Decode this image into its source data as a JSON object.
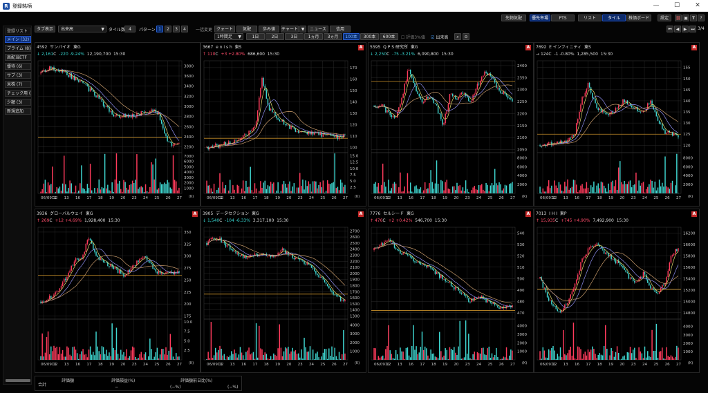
{
  "window": {
    "title": "登録銘柄",
    "icon_label": "R"
  },
  "toolbar_top_right": [
    "先物気配",
    "優先市場",
    "PTS",
    "リスト",
    "タイル",
    "株価ボード",
    "設定"
  ],
  "page_indicator": "3/4",
  "toolbar": {
    "tab_display": "タブ表示",
    "market_select": "出来高",
    "tile_count_label": "タイル数",
    "tile_count": "4",
    "pattern_label": "パターン",
    "patterns": [
      "1",
      "2",
      "3",
      "4"
    ],
    "bulk_change": "一括変更",
    "views": [
      "クォート",
      "気配",
      "歩み値",
      "チャート",
      "ニュース",
      "信用"
    ],
    "interval": "1時間足",
    "ranges": [
      "1日",
      "2日",
      "3日",
      "1ヵ月",
      "3ヵ月",
      "100本",
      "300本",
      "600本"
    ],
    "range_active": "100本",
    "check_eval": "評価3%値",
    "check_volume": "出来高"
  },
  "sidebar": {
    "header": "登録リスト",
    "items": [
      {
        "label": "メイン (32)",
        "active": true
      },
      {
        "label": "プライム (8)",
        "active": false
      },
      {
        "label": "高配当ETF",
        "active": false
      },
      {
        "label": "優待 (6)",
        "active": false
      },
      {
        "label": "サブ (3)",
        "active": false
      },
      {
        "label": "米株 (7)",
        "active": false
      },
      {
        "label": "チェック用 (",
        "active": false
      },
      {
        "label": "少額 (3)",
        "active": false
      },
      {
        "label": "新規追加",
        "active": false
      }
    ]
  },
  "x_axis_labels": [
    "06/0911",
    "12",
    "13",
    "16",
    "17",
    "18",
    "19",
    "20",
    "23",
    "24",
    "25",
    "26",
    "27"
  ],
  "volume_unit": "(K)",
  "colors": {
    "up": "#ff3b5c",
    "down": "#3fd6d0",
    "ma1": "#e6dd6e",
    "ma2": "#8f8ff0",
    "ma3": "#c79a6a",
    "hline": "#c8902a"
  },
  "panels": [
    {
      "code": "4592",
      "name": "サンバイオ",
      "market": "東G",
      "price": "2,161",
      "flag": "C",
      "change": "-220",
      "pct": "-9.24%",
      "volume": "12,190,700",
      "time": "15:30",
      "dir": "down",
      "arrow": "↓",
      "alert": false,
      "price_ticks": [
        "3800",
        "3600",
        "3400",
        "3200",
        "3000",
        "2800",
        "2600",
        "2400",
        "2200"
      ],
      "price_min": 2100,
      "price_max": 3900,
      "vol_ticks": [
        "7000",
        "6000",
        "5000",
        "4000",
        "3000",
        "2000",
        "1000"
      ],
      "vol_max": 7500,
      "hline": 2380,
      "path": [
        3650,
        3760,
        3720,
        3690,
        3620,
        3550,
        3480,
        3330,
        3220,
        3060,
        2900,
        2800,
        2840,
        2800,
        2850,
        2880,
        2930,
        2870,
        2400,
        2200,
        2230
      ]
    },
    {
      "code": "3667",
      "name": "e n i s h",
      "market": "東S",
      "price": "110",
      "flag": "C",
      "change": "+3",
      "pct": "+2.80%",
      "volume": "686,600",
      "time": "15:30",
      "dir": "up",
      "arrow": "↑",
      "alert": true,
      "price_ticks": [
        "170",
        "160",
        "150",
        "140",
        "130",
        "120",
        "110",
        "100"
      ],
      "price_min": 96,
      "price_max": 176,
      "vol_ticks": [
        "15.0",
        "12.5",
        "10.0",
        "7.5",
        "5.0",
        "2.5"
      ],
      "vol_max": 16,
      "hline": 108,
      "path": [
        100,
        101,
        102,
        104,
        105,
        108,
        112,
        118,
        160,
        135,
        128,
        122,
        118,
        115,
        114,
        113,
        112,
        111,
        110,
        109,
        110
      ]
    },
    {
      "code": "5595",
      "name": "Q P S 研究所",
      "market": "東G",
      "price": "2,250",
      "flag": "C",
      "change": "-75",
      "pct": "-3.21%",
      "volume": "6,090,800",
      "time": "15:30",
      "dir": "down",
      "arrow": "↓",
      "alert": true,
      "price_ticks": [
        "2400",
        "2350",
        "2300",
        "2250",
        "2200",
        "2150",
        "2100",
        "2050"
      ],
      "price_min": 2040,
      "price_max": 2420,
      "vol_ticks": [
        "8000",
        "6000",
        "4000",
        "2000"
      ],
      "vol_max": 9000,
      "hline": 2335,
      "path": [
        2230,
        2240,
        2200,
        2180,
        2260,
        2390,
        2300,
        2250,
        2270,
        2230,
        2150,
        2280,
        2260,
        2290,
        2250,
        2320,
        2380,
        2350,
        2300,
        2280,
        2250
      ]
    },
    {
      "code": "7692",
      "name": "E インフィニティ",
      "market": "東S",
      "price": "124",
      "flag": "C",
      "change": "-1",
      "pct": "-0.80%",
      "volume": "1,285,500",
      "time": "15:30",
      "dir": "neutral",
      "arrow": "→",
      "alert": true,
      "price_ticks": [
        "155",
        "150",
        "145",
        "140",
        "135",
        "130",
        "125",
        "120"
      ],
      "price_min": 117,
      "price_max": 158,
      "vol_ticks": [
        "8000",
        "6000",
        "4000",
        "2000"
      ],
      "vol_max": 9000,
      "hline": 125,
      "path": [
        120,
        120,
        121,
        121,
        122,
        125,
        140,
        148,
        138,
        135,
        134,
        136,
        140,
        138,
        136,
        135,
        140,
        132,
        126,
        125,
        124
      ]
    },
    {
      "code": "3936",
      "name": "グローバルウェイ",
      "market": "東G",
      "price": "269",
      "flag": "C",
      "change": "+12",
      "pct": "+4.69%",
      "volume": "1,928,400",
      "time": "15:30",
      "dir": "up",
      "arrow": "↑",
      "alert": true,
      "price_ticks": [
        "350",
        "325",
        "300",
        "275",
        "250",
        "225",
        "200",
        "175"
      ],
      "price_min": 170,
      "price_max": 360,
      "vol_ticks": [
        "10.0",
        "7.5",
        "5.0",
        "2.5"
      ],
      "vol_max": 10.5,
      "hline": 260,
      "path": [
        205,
        210,
        220,
        240,
        265,
        290,
        300,
        340,
        300,
        285,
        280,
        270,
        260,
        275,
        290,
        300,
        280,
        265,
        262,
        266,
        269
      ]
    },
    {
      "code": "3905",
      "name": "データセクション",
      "market": "東G",
      "price": "1,540",
      "flag": "C",
      "change": "-104",
      "pct": "-6.33%",
      "volume": "3,317,100",
      "time": "15:30",
      "dir": "down",
      "arrow": "↓",
      "alert": true,
      "price_ticks": [
        "2700",
        "2600",
        "2500",
        "2400",
        "2300",
        "2200",
        "2100",
        "2000",
        "1900",
        "1800",
        "1700",
        "1600",
        "1500",
        "1400",
        "1300"
      ],
      "price_min": 1260,
      "price_max": 2760,
      "vol_ticks": [
        "4000",
        "3000",
        "2000",
        "1000"
      ],
      "vol_max": 4600,
      "hline": 1660,
      "path": [
        2500,
        2600,
        2550,
        2450,
        2380,
        2300,
        2250,
        2300,
        2350,
        2280,
        2320,
        2380,
        2300,
        2250,
        2200,
        2150,
        2000,
        1850,
        1700,
        1600,
        1540
      ]
    },
    {
      "code": "7776",
      "name": "セルシード",
      "market": "東G",
      "price": "476",
      "flag": "C",
      "change": "+2",
      "pct": "+0.42%",
      "volume": "546,700",
      "time": "15:30",
      "dir": "up",
      "arrow": "↑",
      "alert": true,
      "price_ticks": [
        "540",
        "530",
        "520",
        "510",
        "500",
        "490",
        "480",
        "470"
      ],
      "price_min": 465,
      "price_max": 545,
      "vol_ticks": [
        "4000",
        "3000",
        "2000",
        "1000"
      ],
      "vol_max": 4700,
      "hline": 472,
      "path": [
        525,
        530,
        535,
        528,
        522,
        520,
        515,
        512,
        510,
        505,
        500,
        495,
        490,
        485,
        480,
        485,
        482,
        478,
        474,
        475,
        476
      ]
    },
    {
      "code": "7013",
      "name": "I H I",
      "market": "東P",
      "price": "15,935",
      "flag": "C",
      "change": "+745",
      "pct": "+4.90%",
      "volume": "7,492,900",
      "time": "15:30",
      "dir": "up",
      "arrow": "↑",
      "alert": true,
      "price_ticks": [
        "16200",
        "16000",
        "15800",
        "15600",
        "15400",
        "15200",
        "15000",
        "14800"
      ],
      "price_min": 14700,
      "price_max": 16300,
      "vol_ticks": [
        "4000",
        "3000",
        "2000",
        "1000"
      ],
      "vol_max": 4800,
      "hline": 15210,
      "path": [
        15400,
        15100,
        14900,
        14800,
        15000,
        15300,
        15700,
        15900,
        16000,
        15900,
        15800,
        15700,
        15600,
        15400,
        15300,
        15500,
        15200,
        15150,
        15300,
        15800,
        15935
      ]
    }
  ],
  "footer": {
    "total_label": "合計",
    "eval_label": "評価額",
    "pl_label": "評価損益(%)",
    "prev_label": "評価額前日比(%)",
    "eval_value": "−",
    "pl_value": "(−%)",
    "prev_value": "(−%)"
  }
}
